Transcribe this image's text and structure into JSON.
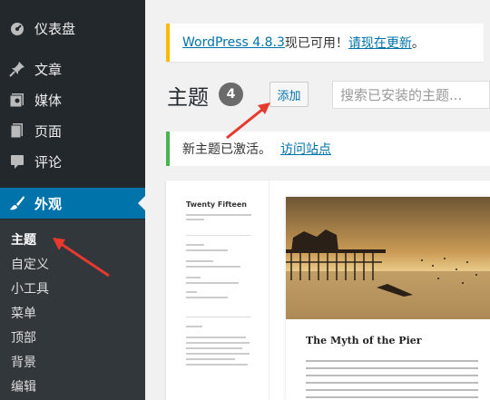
{
  "sidebar": {
    "items": [
      {
        "label": "仪表盘",
        "icon": "dashboard-icon"
      },
      {
        "label": "文章",
        "icon": "pin-icon"
      },
      {
        "label": "媒体",
        "icon": "media-icon"
      },
      {
        "label": "页面",
        "icon": "page-icon"
      },
      {
        "label": "评论",
        "icon": "comment-icon"
      },
      {
        "label": "外观",
        "icon": "paintbrush-icon"
      }
    ],
    "submenu": [
      "主题",
      "自定义",
      "小工具",
      "菜单",
      "顶部",
      "背景",
      "编辑"
    ]
  },
  "update_notice": {
    "version_link": "WordPress 4.8.3",
    "middle_text": "现已可用！",
    "update_link": "请现在更新",
    "end_text": "。"
  },
  "header": {
    "title": "主题",
    "count": "4",
    "add_label": "添加",
    "search_placeholder": "搜索已安装的主题..."
  },
  "activated_notice": {
    "text": "新主题已激活。",
    "link": "访问站点"
  },
  "theme_preview": {
    "site_title": "Twenty Fifteen",
    "post_title": "The Myth of the Pier"
  },
  "colors": {
    "sidebar_bg": "#23282d",
    "active_blue": "#0073aa",
    "update_border": "#ffb900",
    "success_border": "#46b450",
    "annotation_arrow": "#e8392e"
  }
}
